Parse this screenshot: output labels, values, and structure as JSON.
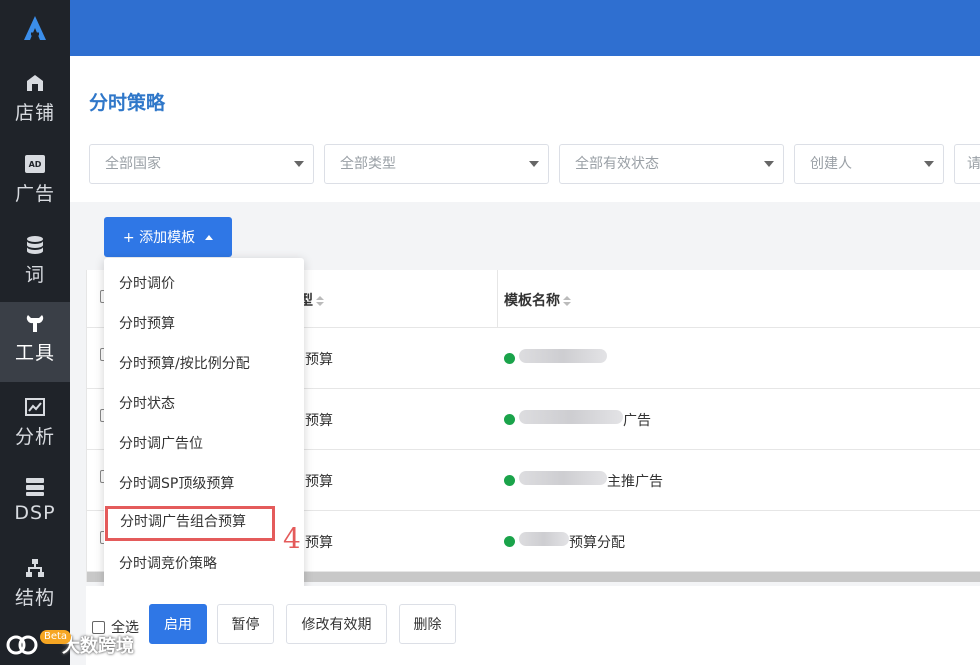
{
  "sidebar": {
    "items": [
      {
        "label": "店铺",
        "icon": "store-icon"
      },
      {
        "label": "广告",
        "icon": "ad-icon"
      },
      {
        "label": "词",
        "icon": "database-icon"
      },
      {
        "label": "工具",
        "icon": "wrench-icon"
      },
      {
        "label": "分析",
        "icon": "chart-icon"
      },
      {
        "label": "DSP",
        "icon": "server-icon"
      },
      {
        "label": "结构",
        "icon": "hierarchy-icon"
      }
    ],
    "ad_badge": "AD"
  },
  "page": {
    "title": "分时策略"
  },
  "filters": {
    "country": "全部国家",
    "type": "全部类型",
    "status": "全部有效状态",
    "creator": "创建人",
    "more": "请"
  },
  "add_button": {
    "label": "+ 添加模板"
  },
  "menu": {
    "items": [
      "分时调价",
      "分时预算",
      "分时预算/按比例分配",
      "分时状态",
      "分时调广告位",
      "分时调SP顶级预算",
      "分时调广告组合预算",
      "分时调竞价策略"
    ],
    "step_marker": "4"
  },
  "table": {
    "headers": {
      "type_suffix": "型",
      "name": "模板名称"
    },
    "rows": [
      {
        "type": "预算",
        "name_tail": ""
      },
      {
        "type": "预算",
        "name_tail": "广告"
      },
      {
        "type": "预算",
        "name_tail": "主推广告"
      },
      {
        "type": "预算",
        "name_tail": "预算分配"
      }
    ]
  },
  "bottom": {
    "select_all": "全选",
    "enable": "启用",
    "pause": "暂停",
    "modify_validity": "修改有效期",
    "delete": "删除"
  },
  "watermark": {
    "beta": "Beta",
    "text": "大数跨境"
  },
  "colors": {
    "header": "#2f6fd0",
    "primary": "#2f77e6",
    "highlight": "#e45b5b",
    "status_dot": "#1aa34a"
  }
}
